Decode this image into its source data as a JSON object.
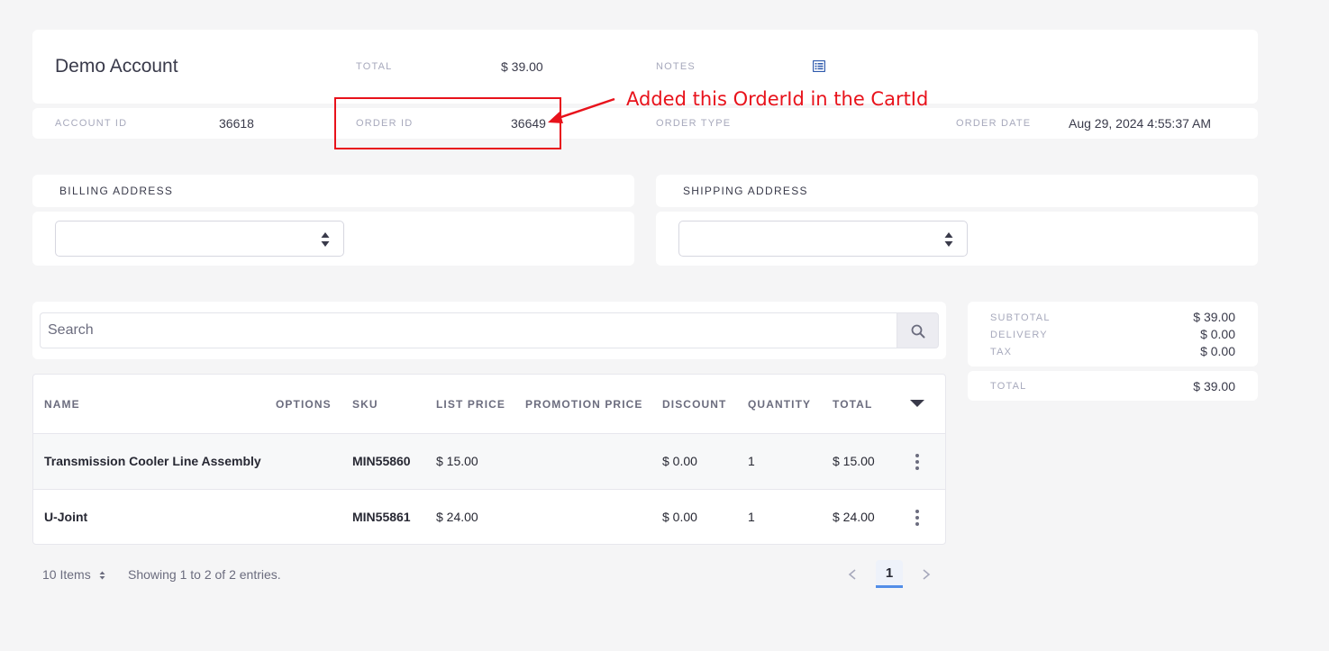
{
  "header": {
    "account_name": "Demo Account",
    "total_label": "TOTAL",
    "total_value": "$ 39.00",
    "notes_label": "NOTES",
    "notes_icon": "list-icon",
    "account_id_label": "ACCOUNT ID",
    "account_id_value": "36618",
    "order_id_label": "ORDER ID",
    "order_id_value": "36649",
    "order_type_label": "ORDER TYPE",
    "order_date_label": "ORDER DATE",
    "order_date_value": "Aug 29, 2024 4:55:37 AM"
  },
  "annotation": {
    "text": "Added this OrderId in the CartId",
    "color": "#e8121b"
  },
  "billing": {
    "title": "BILLING ADDRESS",
    "selected": ""
  },
  "shipping": {
    "title": "SHIPPING ADDRESS",
    "selected": ""
  },
  "search": {
    "placeholder": "Search"
  },
  "table": {
    "columns": [
      "NAME",
      "OPTIONS",
      "SKU",
      "LIST PRICE",
      "PROMOTION PRICE",
      "DISCOUNT",
      "QUANTITY",
      "TOTAL"
    ],
    "rows": [
      {
        "name": "Transmission Cooler Line Assembly",
        "options": "",
        "sku": "MIN55860",
        "list_price": "$ 15.00",
        "promotion_price": "",
        "discount": "$ 0.00",
        "quantity": "1",
        "total": "$ 15.00"
      },
      {
        "name": "U-Joint",
        "options": "",
        "sku": "MIN55861",
        "list_price": "$ 24.00",
        "promotion_price": "",
        "discount": "$ 0.00",
        "quantity": "1",
        "total": "$ 24.00"
      }
    ]
  },
  "pagination": {
    "per_page": "10 Items",
    "showing": "Showing 1 to 2 of 2 entries.",
    "current_page": "1"
  },
  "summary": {
    "subtotal_label": "SUBTOTAL",
    "subtotal_value": "$ 39.00",
    "delivery_label": "DELIVERY",
    "delivery_value": "$ 0.00",
    "tax_label": "TAX",
    "tax_value": "$ 0.00",
    "total_label": "TOTAL",
    "total_value": "$ 39.00"
  },
  "colors": {
    "accent": "#528de8",
    "annotation": "#e8121b",
    "background": "#f5f5f6"
  }
}
